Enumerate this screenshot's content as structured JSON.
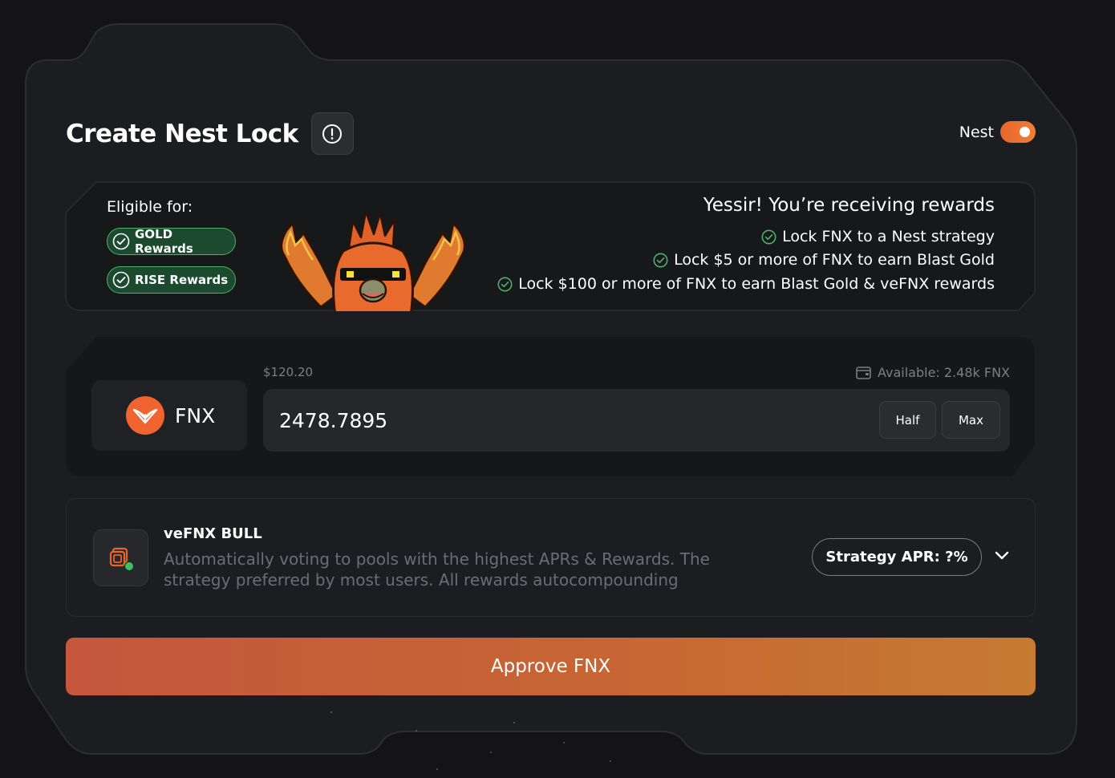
{
  "header": {
    "title": "Create Nest Lock",
    "nest_label": "Nest",
    "nest_enabled": true
  },
  "eligibility": {
    "label": "Eligible for:",
    "badges": [
      "GOLD Rewards",
      "RISE Rewards"
    ]
  },
  "rewards": {
    "heading": "Yessir! You’re receiving rewards",
    "lines": [
      "Lock FNX to a Nest strategy",
      "Lock $5 or more of FNX to earn Blast Gold",
      "Lock $100 or more of FNX to earn Blast Gold & veFNX rewards"
    ]
  },
  "token": {
    "symbol": "FNX",
    "icon": "fenix-logo-icon",
    "usd_value": "$120.20",
    "available": "Available: 2.48k FNX",
    "amount": "2478.7895",
    "half_label": "Half",
    "max_label": "Max"
  },
  "strategy": {
    "title": "veFNX BULL",
    "description": "Automatically voting to pools with the highest APRs & Rewards. The strategy preferred by most users. All rewards autocompounding",
    "apr_label": "Strategy APR: ?%",
    "icon": "stacked-layers-icon"
  },
  "actions": {
    "approve_label": "Approve FNX"
  },
  "colors": {
    "accent": "#e8662c",
    "success": "#4fb06a",
    "background": "#141416",
    "panel": "#1c1d20"
  }
}
